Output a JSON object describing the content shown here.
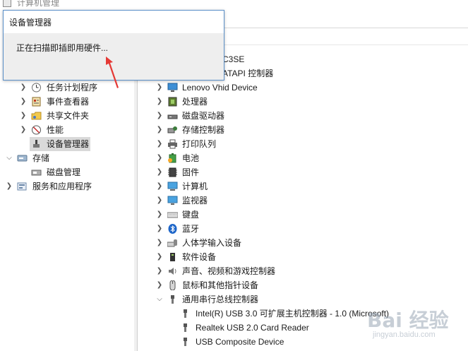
{
  "window": {
    "title": "计算机管理"
  },
  "popup": {
    "title": "设备管理器",
    "message": "正在扫描即插即用硬件..."
  },
  "left_tree": [
    {
      "label": "任务计划程序",
      "icon": "clock-icon",
      "expand": "collapsed"
    },
    {
      "label": "事件查看器",
      "icon": "event-log-icon",
      "expand": "collapsed"
    },
    {
      "label": "共享文件夹",
      "icon": "shared-folder-icon",
      "expand": "collapsed"
    },
    {
      "label": "性能",
      "icon": "performance-icon",
      "expand": "collapsed"
    },
    {
      "label": "设备管理器",
      "icon": "device-manager-icon",
      "expand": "none",
      "selected": true
    },
    {
      "label": "存储",
      "icon": "storage-icon",
      "expand": "expanded"
    },
    {
      "label": "磁盘管理",
      "icon": "disk-management-icon",
      "expand": "none"
    },
    {
      "label": "服务和应用程序",
      "icon": "services-icon",
      "expand": "collapsed"
    }
  ],
  "right_tree": {
    "partial_top": [
      "C3SE",
      "ATAPI 控制器"
    ],
    "items": [
      {
        "label": "Lenovo Vhid Device",
        "icon": "monitor-icon",
        "expand": "collapsed"
      },
      {
        "label": "处理器",
        "icon": "cpu-icon",
        "expand": "collapsed"
      },
      {
        "label": "磁盘驱动器",
        "icon": "disk-drive-icon",
        "expand": "collapsed"
      },
      {
        "label": "存储控制器",
        "icon": "storage-controller-icon",
        "expand": "collapsed"
      },
      {
        "label": "打印队列",
        "icon": "printer-icon",
        "expand": "collapsed"
      },
      {
        "label": "电池",
        "icon": "battery-icon",
        "expand": "collapsed"
      },
      {
        "label": "固件",
        "icon": "firmware-icon",
        "expand": "collapsed"
      },
      {
        "label": "计算机",
        "icon": "computer-icon",
        "expand": "collapsed"
      },
      {
        "label": "监视器",
        "icon": "monitor-icon",
        "expand": "collapsed"
      },
      {
        "label": "键盘",
        "icon": "keyboard-icon",
        "expand": "collapsed"
      },
      {
        "label": "蓝牙",
        "icon": "bluetooth-icon",
        "expand": "collapsed"
      },
      {
        "label": "人体学输入设备",
        "icon": "hid-icon",
        "expand": "collapsed"
      },
      {
        "label": "软件设备",
        "icon": "software-device-icon",
        "expand": "collapsed"
      },
      {
        "label": "声音、视频和游戏控制器",
        "icon": "speaker-icon",
        "expand": "collapsed"
      },
      {
        "label": "鼠标和其他指针设备",
        "icon": "mouse-icon",
        "expand": "collapsed"
      },
      {
        "label": "通用串行总线控制器",
        "icon": "usb-icon",
        "expand": "expanded"
      }
    ],
    "usb_children": [
      {
        "label": "Intel(R) USB 3.0 可扩展主机控制器 - 1.0 (Microsoft)",
        "icon": "usb-icon"
      },
      {
        "label": "Realtek USB 2.0 Card Reader",
        "icon": "usb-icon"
      },
      {
        "label": "USB Composite Device",
        "icon": "usb-icon"
      }
    ]
  },
  "watermark": {
    "main": "Bai 经验",
    "sub": "jingyan.baidu.com"
  },
  "colors": {
    "popup_border": "#5a8fc8",
    "selection": "#d9d9d9",
    "arrow": "#e53935"
  }
}
